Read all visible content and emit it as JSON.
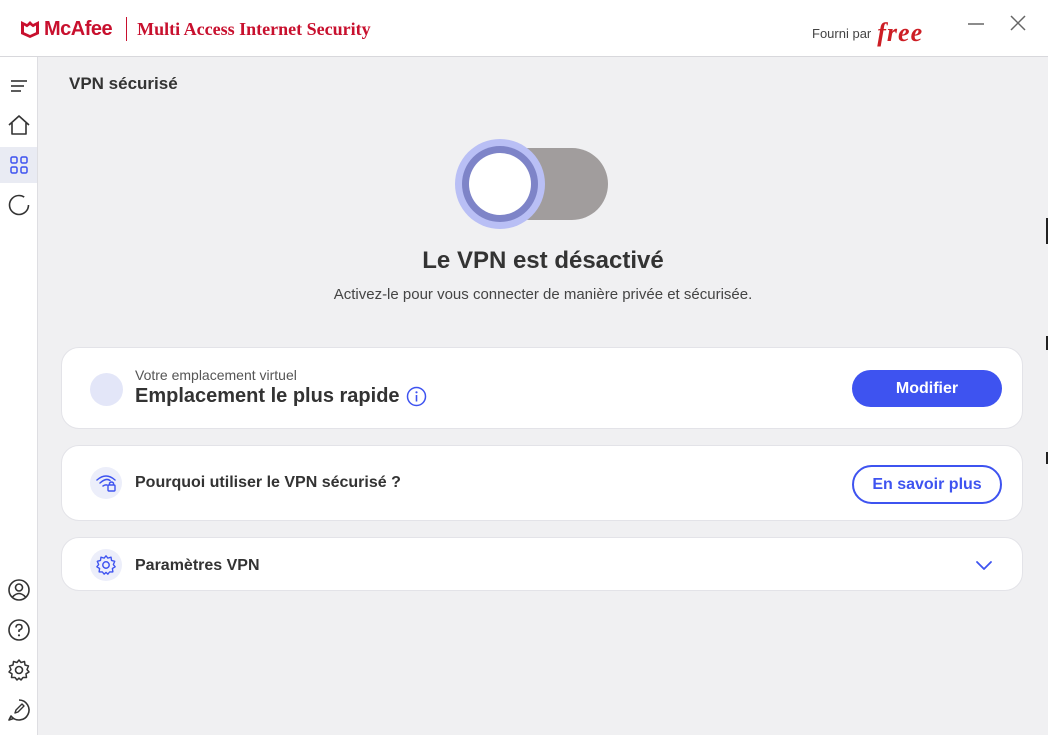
{
  "titlebar": {
    "brand": "McAfee",
    "product": "Multi Access Internet Security",
    "provided_by": "Fourni par",
    "provider": "free",
    "minimize_icon": "minimize-icon",
    "close_icon": "close-icon"
  },
  "sidebar": {
    "items": [
      {
        "name": "menu",
        "icon": "hamburger-menu-icon"
      },
      {
        "name": "home",
        "icon": "home-icon"
      },
      {
        "name": "apps",
        "icon": "grid-icon",
        "active": true
      },
      {
        "name": "scan",
        "icon": "circle-progress-icon"
      }
    ],
    "bottom": [
      {
        "name": "account",
        "icon": "user-icon"
      },
      {
        "name": "help",
        "icon": "help-icon"
      },
      {
        "name": "settings",
        "icon": "gear-icon"
      },
      {
        "name": "feedback",
        "icon": "feedback-icon"
      }
    ]
  },
  "page": {
    "title": "VPN sécurisé"
  },
  "vpn": {
    "enabled": false,
    "status_title": "Le VPN est désactivé",
    "status_subtitle": "Activez-le pour vous connecter de manière privée et sécurisée."
  },
  "location_card": {
    "label": "Votre emplacement virtuel",
    "value": "Emplacement le plus rapide",
    "button": "Modifier"
  },
  "why_card": {
    "text": "Pourquoi utiliser le VPN sécurisé ?",
    "button": "En savoir plus"
  },
  "settings_card": {
    "text": "Paramètres VPN"
  },
  "colors": {
    "brand_red": "#c8102e",
    "accent_blue": "#3e53f0",
    "toggle_off": "#a19d9d"
  }
}
